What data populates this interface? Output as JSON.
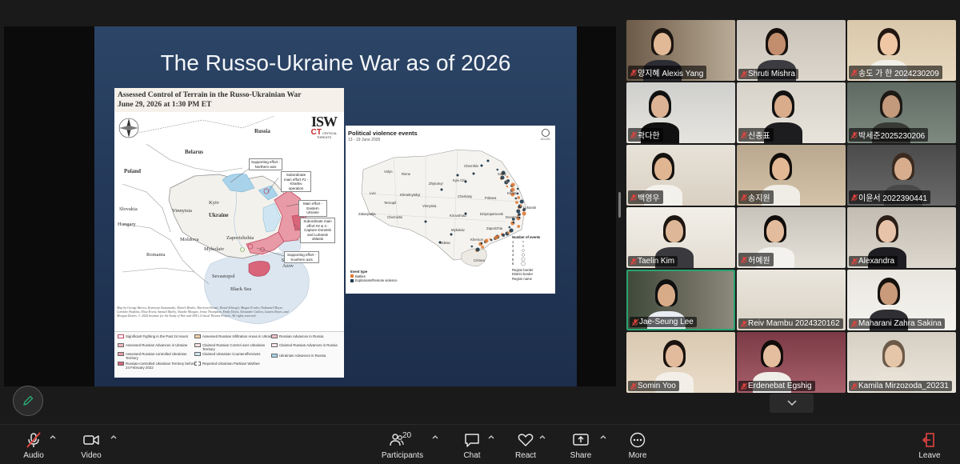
{
  "slide": {
    "title": "The Russo-Ukraine War as of 2026"
  },
  "map_isw": {
    "title": "Assessed Control of Terrain in the Russo-Ukrainian War",
    "date": "June 29, 2026 at 1:30 PM ET",
    "logo": "ISW",
    "logo_ct": "CRITICAL THREATS",
    "labels": {
      "russia": "Russia",
      "belarus": "Belarus",
      "poland": "Poland",
      "slovakia": "Slovakia",
      "hungary": "Hungary",
      "romania": "Romania",
      "moldova": "Moldova",
      "ukraine": "Ukraine",
      "kyiv": "Kyiv",
      "vinnytsia": "Vinnytsia",
      "zaporizhzhia": "Zaporizhzhia",
      "mykolaiv": "Mykolaiv",
      "sea_azov": "Sea of Azov",
      "black_sea": "Black Sea",
      "sevastopol": "Sevastopol"
    },
    "callouts": [
      "Supporting effort - Northern axis",
      "Subordinate main effort #1 - Kharkiv operation",
      "Main effort - Eastern Ukraine",
      "Subordinate main effort #2 & 3 - Capture Donetsk and Luhansk oblasts",
      "Supporting effort - Southern axis"
    ],
    "credits": "Map by George Barros, Kateryna Stepanenko, Daniel Mealie, Harrison Hewitt, David Schiegel, Megan Fowler, Nathaniel Meyer, Caroline Hopkins, Elisa Evens, Samuel Bailey, Natalie Morgan, Jenny Thompson, Emily Davis, Alexander Cutlow, Lauren Reyes, and Morgan Davies. © 2026 Institute for the Study of War and AEI's Critical Threats Project. All rights reserved.",
    "legend": [
      "Significant Fighting in the Past 24 Hours",
      "Assessed Russian Advances in Ukraine",
      "Assessed Russian-controlled Ukrainian Territory",
      "Russian-controlled Ukrainian Territory before 24 February 2022",
      "Assessed Russian Infiltration Areas in Ukraine",
      "Claimed Russian Control over Ukrainian Territory",
      "Claimed Ukrainian Counteroffensives",
      "Reported Ukrainian Partisan Warfare",
      "Russian Advances in Russia",
      "Claimed Russian Advances in Russia",
      "Ukrainian Advances in Russia"
    ]
  },
  "map_acled": {
    "title": "Political violence events",
    "subtitle": "13 - 19 June 2026",
    "logo": "ACLED",
    "cities": [
      "Chernihiv",
      "Sumy",
      "Kyiv City",
      "Kharkiv",
      "Zhytomyr",
      "Poltava",
      "Volyn",
      "Rivne",
      "Lviv",
      "Khmelnytskyi",
      "Ternopil",
      "Vinnytsia",
      "Cherkasy",
      "Kirovohrad",
      "Dnipropetrovsk",
      "Donetsk",
      "Luhansk",
      "Zakarpattia",
      "Chernivtsi",
      "Mykolaiv",
      "Zaporizhia",
      "Kherson",
      "Odesa",
      "Crimea"
    ],
    "event_type_label": "Event type",
    "event_types": [
      "Battles",
      "Explosions/Remote violence"
    ],
    "size_label": "Number of events",
    "size_values": [
      "1",
      "2",
      "3",
      "4",
      "5",
      "6"
    ],
    "border_items": [
      "Region border",
      "District border",
      "Region name"
    ],
    "colors": {
      "battles": "#e07b39",
      "explosions": "#1f3a4d"
    }
  },
  "gallery": {
    "participants": [
      {
        "name": "양지혜 Alexis Yang"
      },
      {
        "name": "Shruti Mishra"
      },
      {
        "name": "송도 가 한 2024230209"
      },
      {
        "name": "곽다한"
      },
      {
        "name": "신종표"
      },
      {
        "name": "박세준2025230206"
      },
      {
        "name": "백영우"
      },
      {
        "name": "송지원"
      },
      {
        "name": "이윤서 2022390441"
      },
      {
        "name": "Taelin Kim"
      },
      {
        "name": "허예원"
      },
      {
        "name": "Alexandra"
      },
      {
        "name": "Jae-Seung Lee"
      },
      {
        "name": "Reiv Mambu 2024320162"
      },
      {
        "name": "Maharani Zahra Sakina"
      },
      {
        "name": "Somin Yoo"
      },
      {
        "name": "Erdenebat Egshig"
      },
      {
        "name": "Kamila Mirzozoda_20231"
      }
    ]
  },
  "toolbar": {
    "audio": "Audio",
    "video": "Video",
    "participants": "Participants",
    "participants_count": "20",
    "chat": "Chat",
    "react": "React",
    "share": "Share",
    "more": "More",
    "leave": "Leave"
  },
  "colors": {
    "active_speaker": "#2aa371",
    "mute_red": "#e0443e",
    "russian_control": "#e8a0a8",
    "pre2022_control": "#d9657a"
  }
}
